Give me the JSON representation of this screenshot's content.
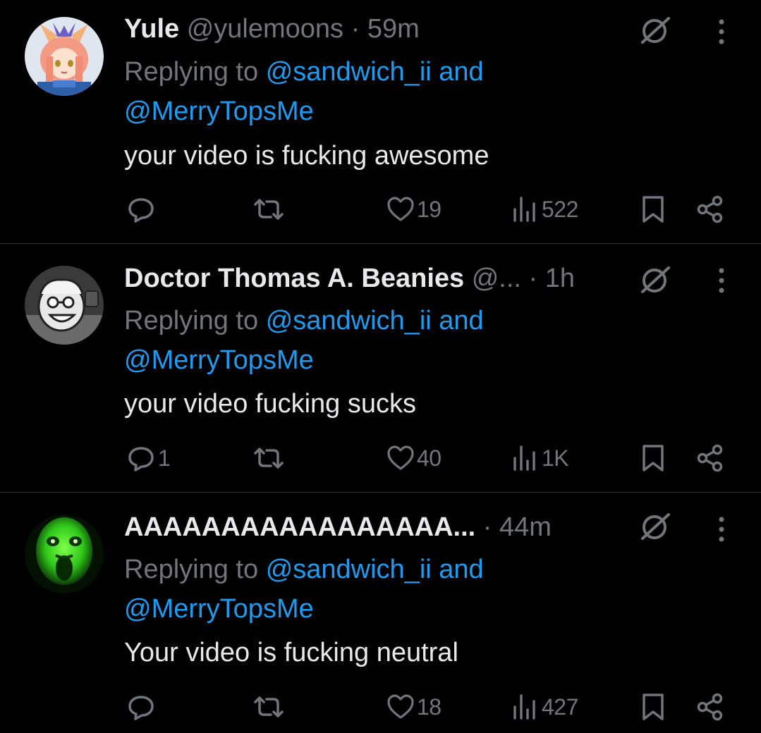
{
  "tweets": [
    {
      "name": "Yule",
      "handle": "@yulemoons",
      "separator": "·",
      "time": "59m",
      "replying_prefix": "Replying to",
      "mention1": "@sandwich_ii",
      "and_word": "and",
      "mention2": "@MerryTopsMe",
      "text": "your video is fucking awesome",
      "replies": "",
      "reposts": "",
      "likes": "19",
      "views": "522"
    },
    {
      "name": "Doctor Thomas A. Beanies",
      "handle": "@...",
      "separator": "·",
      "time": "1h",
      "replying_prefix": "Replying to",
      "mention1": "@sandwich_ii",
      "and_word": "and",
      "mention2": "@MerryTopsMe",
      "text": "your video fucking sucks",
      "replies": "1",
      "reposts": "",
      "likes": "40",
      "views": "1K"
    },
    {
      "name": "AAAAAAAAAAAAAAAAA...",
      "handle": "",
      "separator": "·",
      "time": "44m",
      "replying_prefix": "Replying to",
      "mention1": "@sandwich_ii",
      "and_word": "and",
      "mention2": "@MerryTopsMe",
      "text": "Your video is fucking neutral",
      "replies": "",
      "reposts": "",
      "likes": "18",
      "views": "427"
    }
  ],
  "icons": {
    "reply": "reply-icon",
    "repost": "repost-icon",
    "like": "heart-icon",
    "views": "views-icon",
    "bookmark": "bookmark-icon",
    "share": "share-icon",
    "grok": "grok-icon",
    "more": "more-vertical-icon"
  },
  "colors": {
    "background": "#000000",
    "text_primary": "#e7e9ea",
    "text_secondary": "#71767b",
    "link": "#1d9bf0",
    "divider": "#2f3336"
  }
}
